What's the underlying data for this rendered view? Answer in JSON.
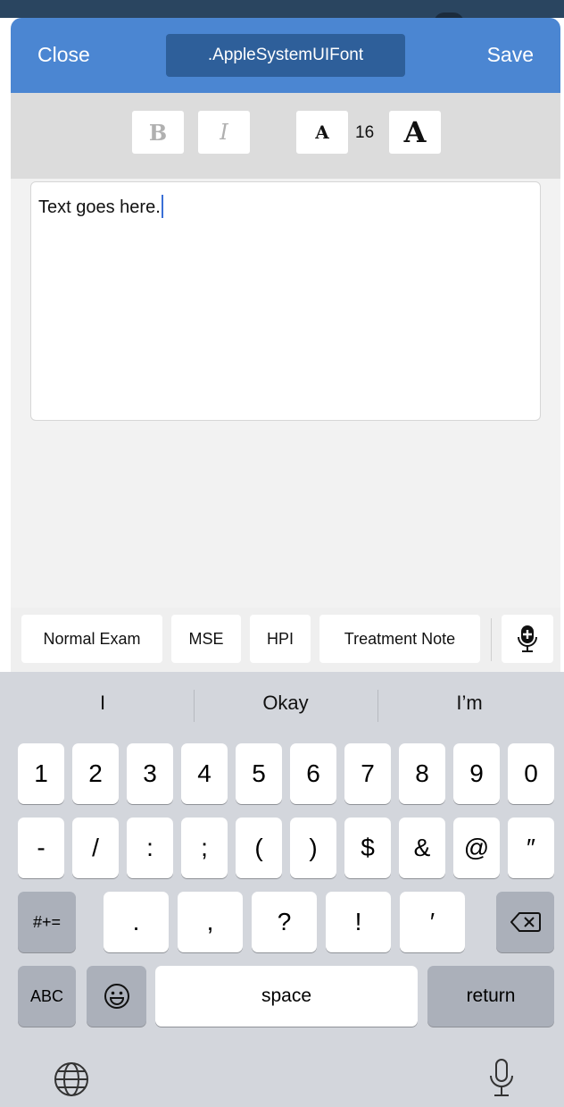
{
  "nav": {
    "close_label": "Close",
    "font_name": ".AppleSystemUIFont",
    "save_label": "Save"
  },
  "toolbar": {
    "bold_label": "B",
    "italic_label": "I",
    "decrease_label": "A",
    "font_size": "16",
    "increase_label": "A"
  },
  "editor": {
    "text": "Text goes here."
  },
  "phrases": [
    {
      "label": "Normal Exam"
    },
    {
      "label": "MSE"
    },
    {
      "label": "HPI"
    },
    {
      "label": "Treatment Note"
    }
  ],
  "suggestions": [
    "I",
    "Okay",
    "I’m"
  ],
  "keyboard": {
    "row1": [
      "1",
      "2",
      "3",
      "4",
      "5",
      "6",
      "7",
      "8",
      "9",
      "0"
    ],
    "row2": [
      "-",
      "/",
      ":",
      ";",
      "(",
      ")",
      "$",
      "&",
      "@",
      "″"
    ],
    "row3_shift": "#+=",
    "row3": [
      ".",
      ",",
      "?",
      "!",
      "′"
    ],
    "abc": "ABC",
    "space": "space",
    "return": "return"
  }
}
